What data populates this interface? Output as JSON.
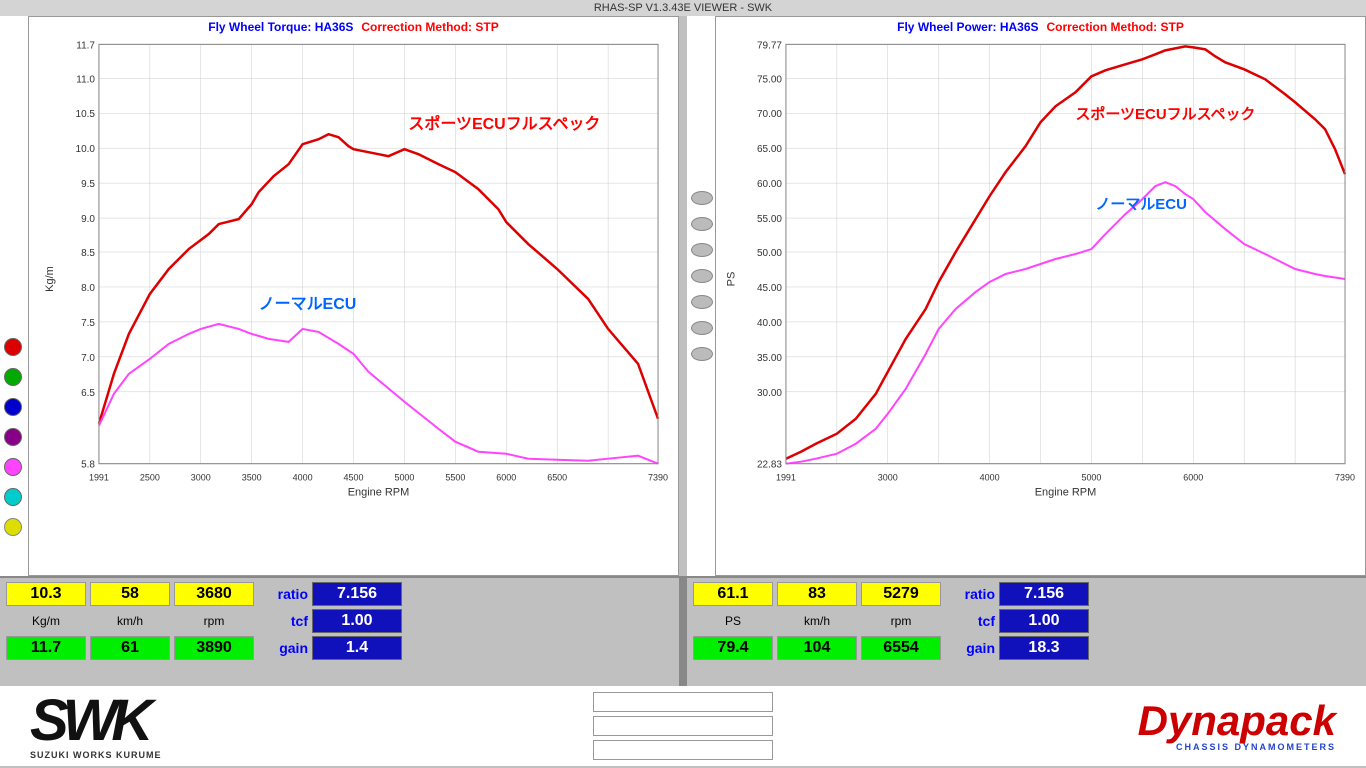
{
  "titleBar": "RHAS-SP V1.3.43E VIEWER - SWK",
  "leftChart": {
    "title1": "Fly Wheel Torque: HA36S",
    "title2": "Correction Method: STP",
    "yAxisLabel": "Kg/m",
    "xAxisLabel": "Engine RPM",
    "label1": "スポーツECUフルスペック",
    "label2": "ノーマルECU",
    "yMin": 5.8,
    "yMax": 11.7,
    "xMin": 1991,
    "xMax": 7390,
    "yTicks": [
      "11.7",
      "11.0",
      "10.5",
      "10.0",
      "9.5",
      "9.0",
      "8.5",
      "8.0",
      "7.5",
      "7.0",
      "6.5",
      "5.8"
    ]
  },
  "rightChart": {
    "title1": "Fly Wheel Power: HA36S",
    "title2": "Correction Method: STP",
    "yAxisLabel": "PS",
    "xAxisLabel": "Engine RPM",
    "label1": "スポーツECUフルスペック",
    "label2": "ノーマルECU",
    "yMin": 22.83,
    "yMax": 79.77,
    "yTicks": [
      "79.77",
      "75.00",
      "70.00",
      "65.00",
      "60.00",
      "55.00",
      "50.00",
      "45.00",
      "40.00",
      "35.00",
      "30.00",
      "22.83"
    ]
  },
  "leftData": {
    "val1": "10.3",
    "val2": "58",
    "val3": "3680",
    "ratio": "ratio",
    "ratioVal": "7.156",
    "unit1": "Kg/m",
    "unit2": "km/h",
    "unit3": "rpm",
    "tcf": "tcf",
    "tcfVal": "1.00",
    "max1": "11.7",
    "max2": "61",
    "max3": "3890",
    "gain": "gain",
    "gainVal": "1.4"
  },
  "rightData": {
    "val1": "61.1",
    "val2": "83",
    "val3": "5279",
    "ratio": "ratio",
    "ratioVal": "7.156",
    "unit1": "PS",
    "unit2": "km/h",
    "unit3": "rpm",
    "tcf": "tcf",
    "tcfVal": "1.00",
    "max1": "79.4",
    "max2": "104",
    "max3": "6554",
    "gain": "gain",
    "gainVal": "18.3"
  },
  "footer": {
    "swkLogo": "SWK",
    "swkSubtitle": "SUZUKI WORKS KURUME",
    "dynapackLogo": "Dynapack",
    "dynapackSub": "CHASSIS   DYNAMOMETERS"
  },
  "xTicks": [
    "1991",
    "2500",
    "3000",
    "3500",
    "4000",
    "4500",
    "5000",
    "5500",
    "6000",
    "6500",
    "7390"
  ],
  "legends": {
    "colors": [
      "#dd0000",
      "#00aa00",
      "#0000cc",
      "#880088",
      "#ff00ff",
      "#00cccc",
      "#dddd00"
    ]
  }
}
